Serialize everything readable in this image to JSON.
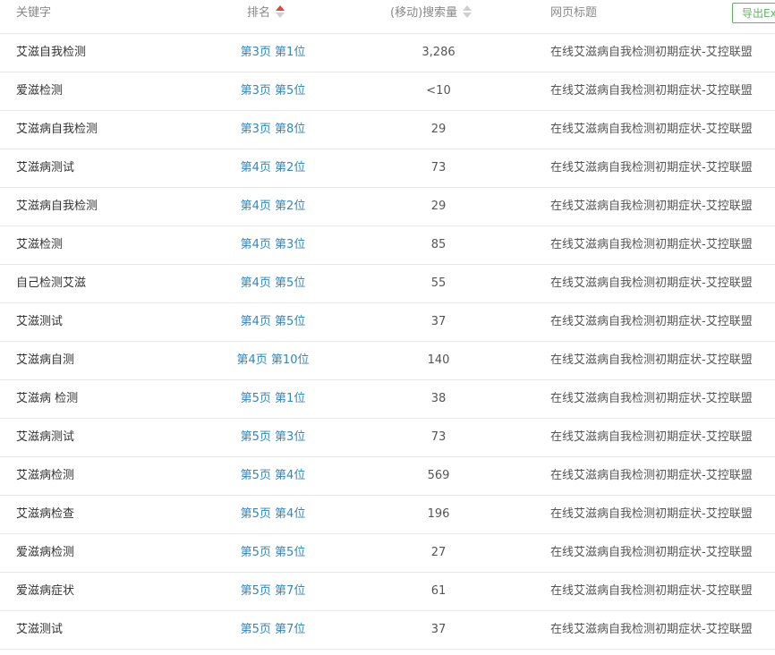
{
  "header": {
    "keyword": "关键字",
    "rank": "排名",
    "volume": "(移动)搜索量",
    "title": "网页标题",
    "export": "导出Excel"
  },
  "rows": [
    {
      "keyword": "艾滋自我检测",
      "rank": "第3页 第1位",
      "volume": "3,286",
      "title": "在线艾滋病自我检测初期症状-艾控联盟"
    },
    {
      "keyword": "爱滋检测",
      "rank": "第3页 第5位",
      "volume": "<10",
      "title": "在线艾滋病自我检测初期症状-艾控联盟"
    },
    {
      "keyword": "艾滋病自我检测",
      "rank": "第3页 第8位",
      "volume": "29",
      "title": "在线艾滋病自我检测初期症状-艾控联盟"
    },
    {
      "keyword": "艾滋病测试",
      "rank": "第4页 第2位",
      "volume": "73",
      "title": "在线艾滋病自我检测初期症状-艾控联盟"
    },
    {
      "keyword": "艾滋病自我检测",
      "rank": "第4页 第2位",
      "volume": "29",
      "title": "在线艾滋病自我检测初期症状-艾控联盟"
    },
    {
      "keyword": "艾滋检测",
      "rank": "第4页 第3位",
      "volume": "85",
      "title": "在线艾滋病自我检测初期症状-艾控联盟"
    },
    {
      "keyword": "自己检测艾滋",
      "rank": "第4页 第5位",
      "volume": "55",
      "title": "在线艾滋病自我检测初期症状-艾控联盟"
    },
    {
      "keyword": "艾滋测试",
      "rank": "第4页 第5位",
      "volume": "37",
      "title": "在线艾滋病自我检测初期症状-艾控联盟"
    },
    {
      "keyword": "艾滋病自测",
      "rank": "第4页 第10位",
      "volume": "140",
      "title": "在线艾滋病自我检测初期症状-艾控联盟"
    },
    {
      "keyword": "艾滋病 检测",
      "rank": "第5页 第1位",
      "volume": "38",
      "title": "在线艾滋病自我检测初期症状-艾控联盟"
    },
    {
      "keyword": "艾滋病测试",
      "rank": "第5页 第3位",
      "volume": "73",
      "title": "在线艾滋病自我检测初期症状-艾控联盟"
    },
    {
      "keyword": "艾滋病检测",
      "rank": "第5页 第4位",
      "volume": "569",
      "title": "在线艾滋病自我检测初期症状-艾控联盟"
    },
    {
      "keyword": "艾滋病检查",
      "rank": "第5页 第4位",
      "volume": "196",
      "title": "在线艾滋病自我检测初期症状-艾控联盟"
    },
    {
      "keyword": "爱滋病检测",
      "rank": "第5页 第5位",
      "volume": "27",
      "title": "在线艾滋病自我检测初期症状-艾控联盟"
    },
    {
      "keyword": "爱滋病症状",
      "rank": "第5页 第7位",
      "volume": "61",
      "title": "在线艾滋病自我检测初期症状-艾控联盟"
    },
    {
      "keyword": "艾滋测试",
      "rank": "第5页 第7位",
      "volume": "37",
      "title": "在线艾滋病自我检测初期症状-艾控联盟"
    }
  ],
  "colors": {
    "link": "#2f87c6",
    "sort_active": "#e8413f",
    "export_button": "#5cb85c",
    "row_border": "#e8e8e8"
  },
  "icons": {
    "rank_sort": "sort-desc-active-icon",
    "volume_sort": "sort-icon"
  }
}
